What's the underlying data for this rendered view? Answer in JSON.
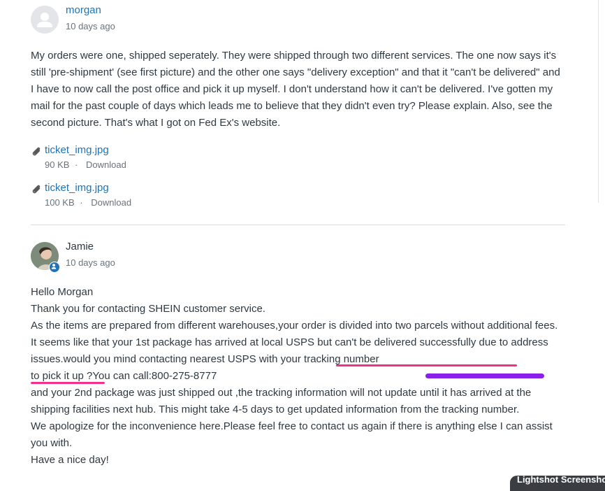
{
  "post1": {
    "author": "morgan",
    "time": "10 days ago",
    "body": [
      "My orders were one, shipped seperately. They were shipped through two different services. The one now says it's still 'pre-shipment' (see first picture) and the other one says \"delivery exception\" and that it \"can't be delivered\" and I have to now call the post office and pick it up myself. I don't understand how it can't be delivered. I've gotten my mail for the past couple of days which leads me to believe that they didn't even try? Please explain. Also, see the second picture. That's what I got on Fed Ex's website."
    ],
    "attachments": [
      {
        "name": "ticket_img.jpg",
        "size": "90 KB",
        "separator": "·",
        "action": "Download"
      },
      {
        "name": "ticket_img.jpg",
        "size": "100 KB",
        "separator": "·",
        "action": "Download"
      }
    ]
  },
  "post2": {
    "author": "Jamie",
    "time": "10 days ago",
    "lines": [
      "Hello Morgan",
      "Thank you for contacting SHEIN customer service.",
      "As the items are prepared from different warehouses,your order is divided into two parcels without additional fees.",
      "It seems like that your 1st package has arrived at local USPS but can't be delivered successfully due to address issues.would you mind contacting nearest USPS with your tracking number",
      "to pick it up ?You can call:800-275-8777",
      "and your 2nd package was just shipped out ,the tracking information will not update until it has arrived at the shipping facilities next hub. This might take 4-5 days to get updated information from the tracking number.",
      "We apologize for the inconvenience here.Please feel free to contact us again if there is anything else I can assist you with.",
      "Have a nice day!"
    ]
  },
  "overlay": {
    "lightshot_label": "Lightshot Screenshot",
    "highlight_color": "#f0328c",
    "redaction_color": "#8a1fe8"
  }
}
